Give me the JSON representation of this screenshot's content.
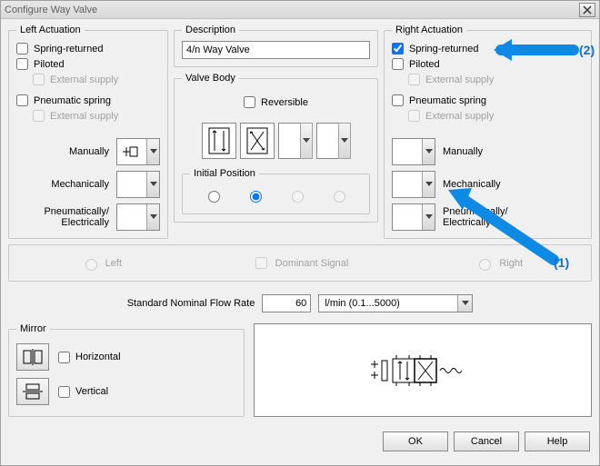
{
  "window": {
    "title": "Configure Way Valve"
  },
  "left_actuation": {
    "legend": "Left Actuation",
    "spring_returned": {
      "label": "Spring-returned",
      "checked": false
    },
    "piloted": {
      "label": "Piloted",
      "checked": false
    },
    "external_supply_1": {
      "label": "External supply"
    },
    "pneumatic_spring": {
      "label": "Pneumatic spring",
      "checked": false
    },
    "external_supply_2": {
      "label": "External supply"
    },
    "manually": "Manually",
    "mechanically": "Mechanically",
    "pneumatically": "Pneumatically/\nElectrically"
  },
  "description": {
    "legend": "Description",
    "value": "4/n Way Valve"
  },
  "valve_body": {
    "legend": "Valve Body",
    "reversible": {
      "label": "Reversible",
      "checked": false
    },
    "initial_position_legend": "Initial Position",
    "initial_position_index": 1
  },
  "right_actuation": {
    "legend": "Right Actuation",
    "spring_returned": {
      "label": "Spring-returned",
      "checked": true
    },
    "piloted": {
      "label": "Piloted",
      "checked": false
    },
    "external_supply_1": {
      "label": "External supply"
    },
    "pneumatic_spring": {
      "label": "Pneumatic spring",
      "checked": false
    },
    "external_supply_2": {
      "label": "External supply"
    },
    "manually": "Manually",
    "mechanically": "Mechanically",
    "pneumatically": "Pneumatically/\nElectrically"
  },
  "dominant": {
    "left": "Left",
    "signal": "Dominant Signal",
    "right": "Right"
  },
  "flow": {
    "label": "Standard Nominal Flow Rate",
    "value": "60",
    "unit": "l/min  (0.1...5000)"
  },
  "mirror": {
    "legend": "Mirror",
    "horizontal": "Horizontal",
    "vertical": "Vertical"
  },
  "buttons": {
    "ok": "OK",
    "cancel": "Cancel",
    "help": "Help"
  },
  "annotations": {
    "a1": "(1)",
    "a2": "(2)"
  }
}
